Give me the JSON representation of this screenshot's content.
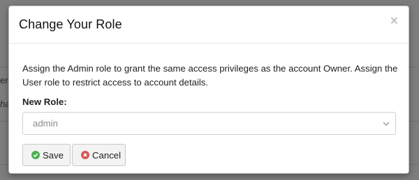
{
  "background": {
    "text_fragment_1": "er",
    "text_fragment_2": "ha"
  },
  "modal": {
    "title": "Change Your Role",
    "close_glyph": "×",
    "description": "Assign the Admin role to grant the same access privileges as the account Owner. Assign the User role to restrict access to account details.",
    "field_label": "New Role:",
    "role_select": {
      "selected": "admin",
      "options": [
        "admin"
      ]
    },
    "buttons": {
      "save_label": "Save",
      "save_icon": "check-circle-icon",
      "cancel_label": "Cancel",
      "cancel_icon": "x-circle-icon"
    }
  },
  "colors": {
    "overlay": "#7a7a7a",
    "save_icon": "#4caf50",
    "cancel_icon": "#d9534f"
  }
}
